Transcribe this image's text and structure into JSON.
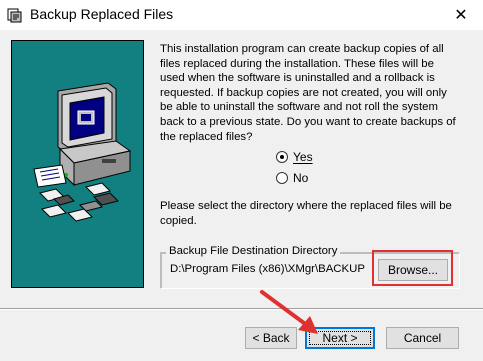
{
  "window": {
    "title": "Backup Replaced Files",
    "close_glyph": "✕",
    "icon": "installer-icon"
  },
  "main": {
    "description": "This installation program can create backup copies of all files replaced during the installation. These files will be used when the software is uninstalled and a rollback is requested.  If backup copies are not created, you will only be able to uninstall the software and not roll the system back to a previous state. Do you want to create backups of the replaced files?",
    "options": [
      {
        "label": "Yes",
        "selected": true
      },
      {
        "label": "No",
        "selected": false
      }
    ],
    "directory_prompt": "Please select the directory where the replaced  files will be copied.",
    "group_label": "Backup File Destination Directory",
    "path": "D:\\Program Files (x86)\\XMgr\\BACKUP",
    "browse_label": "Browse..."
  },
  "footer": {
    "back_label": "< Back",
    "next_label": "Next >",
    "cancel_label": "Cancel"
  },
  "colors": {
    "side_panel": "#128080",
    "annotation": "#e03030",
    "focus_border": "#0078d7"
  }
}
